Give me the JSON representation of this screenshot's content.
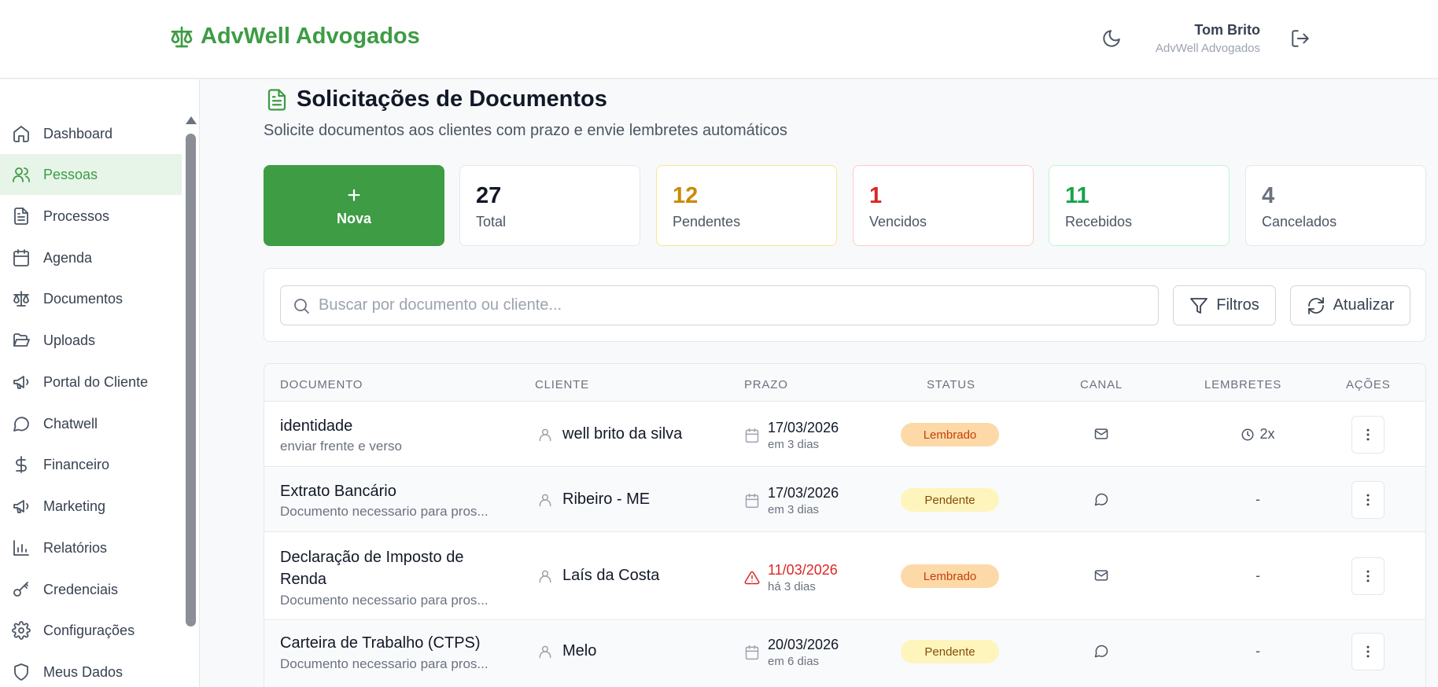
{
  "header": {
    "brand_name": "AdvWell Advogados",
    "user_name": "Tom Brito",
    "user_org": "AdvWell Advogados"
  },
  "sidebar": {
    "items": [
      {
        "label": "Dashboard",
        "icon": "home-icon"
      },
      {
        "label": "Pessoas",
        "icon": "users-icon",
        "active": true
      },
      {
        "label": "Processos",
        "icon": "file-text-icon"
      },
      {
        "label": "Agenda",
        "icon": "calendar-icon"
      },
      {
        "label": "Documentos",
        "icon": "scale-icon"
      },
      {
        "label": "Uploads",
        "icon": "folder-open-icon"
      },
      {
        "label": "Portal do Cliente",
        "icon": "megaphone-icon"
      },
      {
        "label": "Chatwell",
        "icon": "message-circle-icon"
      },
      {
        "label": "Financeiro",
        "icon": "dollar-icon"
      },
      {
        "label": "Marketing",
        "icon": "megaphone-icon"
      },
      {
        "label": "Relatórios",
        "icon": "bar-chart-icon"
      },
      {
        "label": "Credenciais",
        "icon": "key-icon"
      },
      {
        "label": "Configurações",
        "icon": "gear-icon"
      },
      {
        "label": "Meus Dados",
        "icon": "shield-icon"
      }
    ]
  },
  "page": {
    "title": "Solicitações de Documentos",
    "subtitle": "Solicite documentos aos clientes com prazo e envie lembretes automáticos"
  },
  "stats": {
    "new_label": "Nova",
    "new_symbol": "+",
    "cards": [
      {
        "value": "27",
        "label": "Total",
        "color": "#111827",
        "border": "#e5e7eb"
      },
      {
        "value": "12",
        "label": "Pendentes",
        "color": "#ca8a04",
        "border": "#fde68a"
      },
      {
        "value": "1",
        "label": "Vencidos",
        "color": "#dc2626",
        "border": "#fecaca"
      },
      {
        "value": "11",
        "label": "Recebidos",
        "color": "#16a34a",
        "border": "#bbf7d0"
      },
      {
        "value": "4",
        "label": "Cancelados",
        "color": "#6b7280",
        "border": "#e5e7eb"
      }
    ]
  },
  "filters": {
    "search_placeholder": "Buscar por documento ou cliente...",
    "filter_label": "Filtros",
    "refresh_label": "Atualizar"
  },
  "table": {
    "headers": [
      "DOCUMENTO",
      "CLIENTE",
      "PRAZO",
      "STATUS",
      "CANAL",
      "LEMBRETES",
      "AÇÕES"
    ],
    "rows": [
      {
        "title": "identidade",
        "desc": "enviar frente e verso",
        "client": "well brito da silva",
        "date": "17/03/2026",
        "rel": "em 3 dias",
        "status": "Lembrado",
        "channel": "email",
        "reminders": "2x",
        "overdue": false
      },
      {
        "title": "Extrato Bancário",
        "desc": "Documento necessario para pros...",
        "client": "Ribeiro - ME",
        "date": "17/03/2026",
        "rel": "em 3 dias",
        "status": "Pendente",
        "channel": "chat",
        "reminders": "-",
        "overdue": false
      },
      {
        "title": "Declaração de Imposto de Renda",
        "desc": "Documento necessario para pros...",
        "client": "Laís da Costa",
        "date": "11/03/2026",
        "rel": "há 3 dias",
        "status": "Lembrado",
        "channel": "email",
        "reminders": "-",
        "overdue": true
      },
      {
        "title": "Carteira de Trabalho (CTPS)",
        "desc": "Documento necessario para pros...",
        "client": "Melo",
        "date": "20/03/2026",
        "rel": "em 6 dias",
        "status": "Pendente",
        "channel": "chat",
        "reminders": "-",
        "overdue": false
      }
    ]
  }
}
